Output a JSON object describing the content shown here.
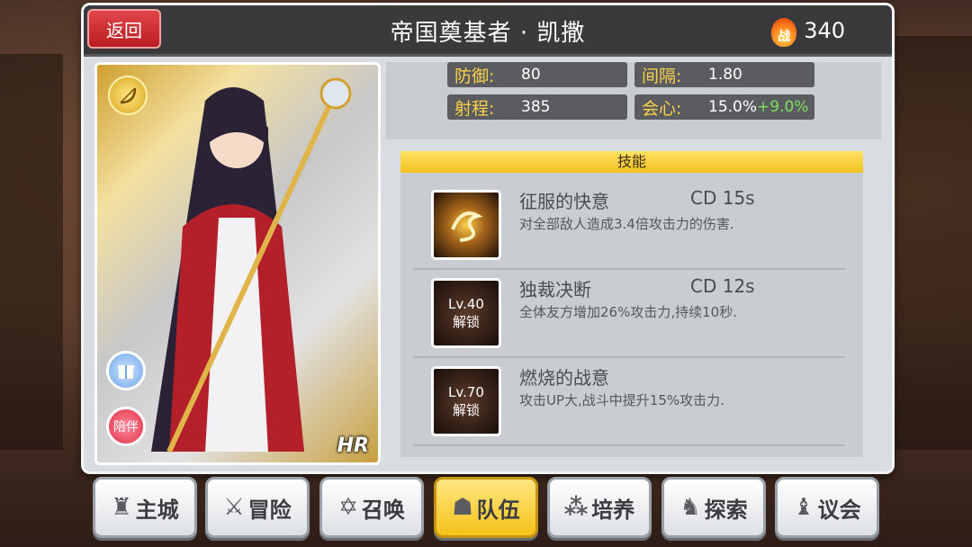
{
  "header": {
    "back_label": "返回",
    "title": "帝国奠基者 · 凯撒",
    "power_icon_label": "战",
    "power_value": "340"
  },
  "portrait": {
    "companion_label": "陪伴",
    "rarity_badge": "HR"
  },
  "stats": [
    {
      "label": "防御:",
      "value": "80"
    },
    {
      "label": "间隔:",
      "value": "1.80"
    },
    {
      "label": "射程:",
      "value": "385"
    },
    {
      "label": "会心:",
      "value": "15.0%",
      "bonus": "+9.0%"
    }
  ],
  "skills": {
    "header": "技能",
    "items": [
      {
        "name": "征服的快意",
        "cd": "CD  15s",
        "desc": "对全部敌人造成3.4倍攻击力的伤害.",
        "lock_level": "",
        "lock_text": ""
      },
      {
        "name": "独裁决断",
        "cd": "CD  12s",
        "desc": "全体友方增加26%攻击力,持续10秒.",
        "lock_level": "Lv.40",
        "lock_text": "解锁"
      },
      {
        "name": "燃烧的战意",
        "cd": "",
        "desc": "攻击UP大,战斗中提升15%攻击力.",
        "lock_level": "Lv.70",
        "lock_text": "解锁"
      }
    ]
  },
  "nav": [
    {
      "label": "主城",
      "icon": "castle-icon"
    },
    {
      "label": "冒险",
      "icon": "crossed-swords-icon"
    },
    {
      "label": "召唤",
      "icon": "summon-circle-icon"
    },
    {
      "label": "队伍",
      "icon": "team-helmet-icon"
    },
    {
      "label": "培养",
      "icon": "train-orbs-icon"
    },
    {
      "label": "探索",
      "icon": "explore-icon"
    },
    {
      "label": "议会",
      "icon": "council-icon"
    }
  ],
  "colors": {
    "accent": "#f5c21a",
    "back_button": "#c9272a",
    "stat_label": "#f8d24a",
    "bonus": "#7ee060"
  }
}
